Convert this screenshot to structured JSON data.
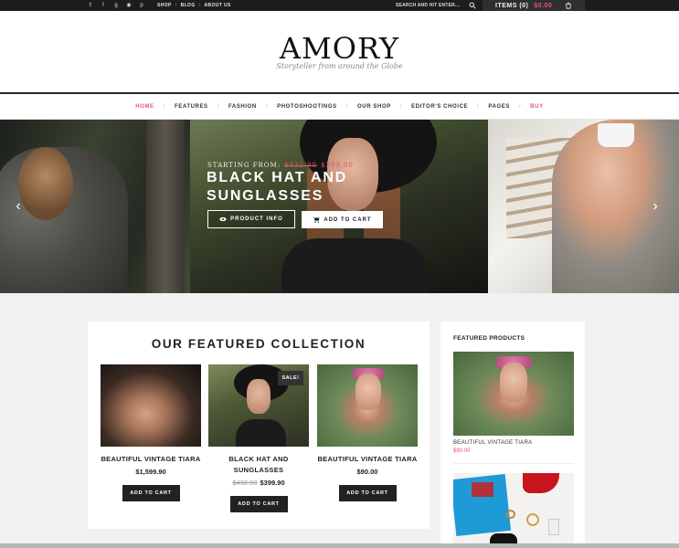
{
  "topbar": {
    "social_icons": [
      "twitter-icon",
      "facebook-icon",
      "google-plus-icon",
      "flickr-icon",
      "pinterest-icon"
    ],
    "links": [
      "SHOP",
      "BLOG",
      "ABOUT US"
    ],
    "search_placeholder": "SEARCH AND HIT ENTER...",
    "cart_items": "ITEMS (0)",
    "cart_total": "$0.00"
  },
  "header": {
    "logo": "AMORY",
    "tagline": "Storyteller from around the Globe"
  },
  "nav": {
    "items": [
      "HOME",
      "FEATURES",
      "FASHION",
      "PHOTOSHOOTINGS",
      "OUR SHOP",
      "EDITOR'S CHOICE",
      "PAGES",
      "BUY"
    ]
  },
  "hero": {
    "starting_label": "STARTING FROM:",
    "old_price": "$432.90",
    "new_price": "$399.90",
    "title": "BLACK HAT AND SUNGLASSES",
    "info_button": "PRODUCT INFO",
    "cart_button": "ADD TO CART"
  },
  "featured": {
    "heading": "OUR FEATURED COLLECTION",
    "products": [
      {
        "name": "BEAUTIFUL VINTAGE TIARA",
        "old_price": "",
        "price": "$1,599.90",
        "button": "ADD TO CART"
      },
      {
        "name": "BLACK HAT AND SUNGLASSES",
        "old_price": "$432.90",
        "price": "$399.90",
        "button": "ADD TO CART",
        "badge": "SALE!"
      },
      {
        "name": "BEAUTIFUL VINTAGE TIARA",
        "old_price": "",
        "price": "$90.00",
        "button": "ADD TO CART"
      }
    ]
  },
  "sidebar": {
    "heading": "FEATURED PRODUCTS",
    "item_name": "BEAUTIFUL VINTAGE TIARA",
    "item_price": "$90.00"
  },
  "colors": {
    "accent": "#e5556a",
    "dark": "#1d1d1d"
  }
}
